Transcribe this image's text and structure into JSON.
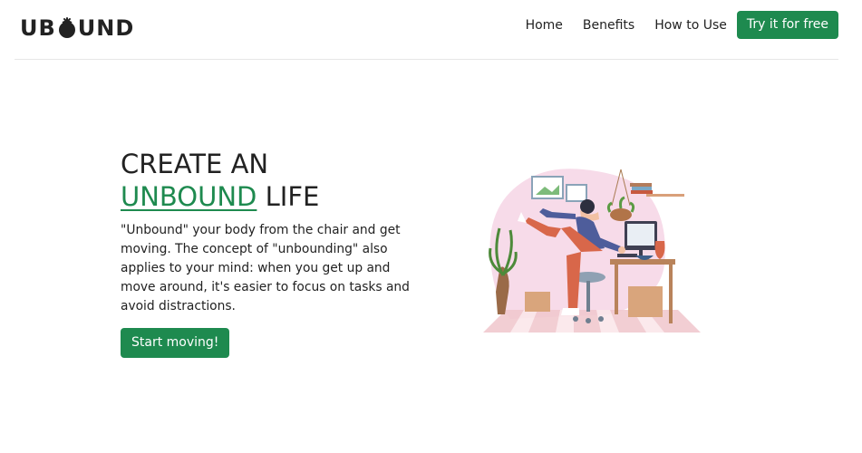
{
  "brand": {
    "name_left": "UB",
    "name_right": "UND",
    "logo_icon": "tomato-o-icon",
    "accent_color": "#1e8a4f"
  },
  "nav": {
    "links": [
      "Home",
      "Benefits",
      "How to Use"
    ],
    "cta_label": "Try it for free"
  },
  "hero": {
    "title_line1": "CREATE AN",
    "title_accent": "UNBOUND",
    "title_rest": " LIFE",
    "body": "\"Unbound\" your body from the chair and get moving. The concept of \"unbounding\" also applies to your mind: when you get up and move around, it's easier to focus on tasks and avoid distractions.",
    "cta_label": "Start moving!",
    "illustration_icon": "woman-stretching-at-desk-illustration"
  }
}
